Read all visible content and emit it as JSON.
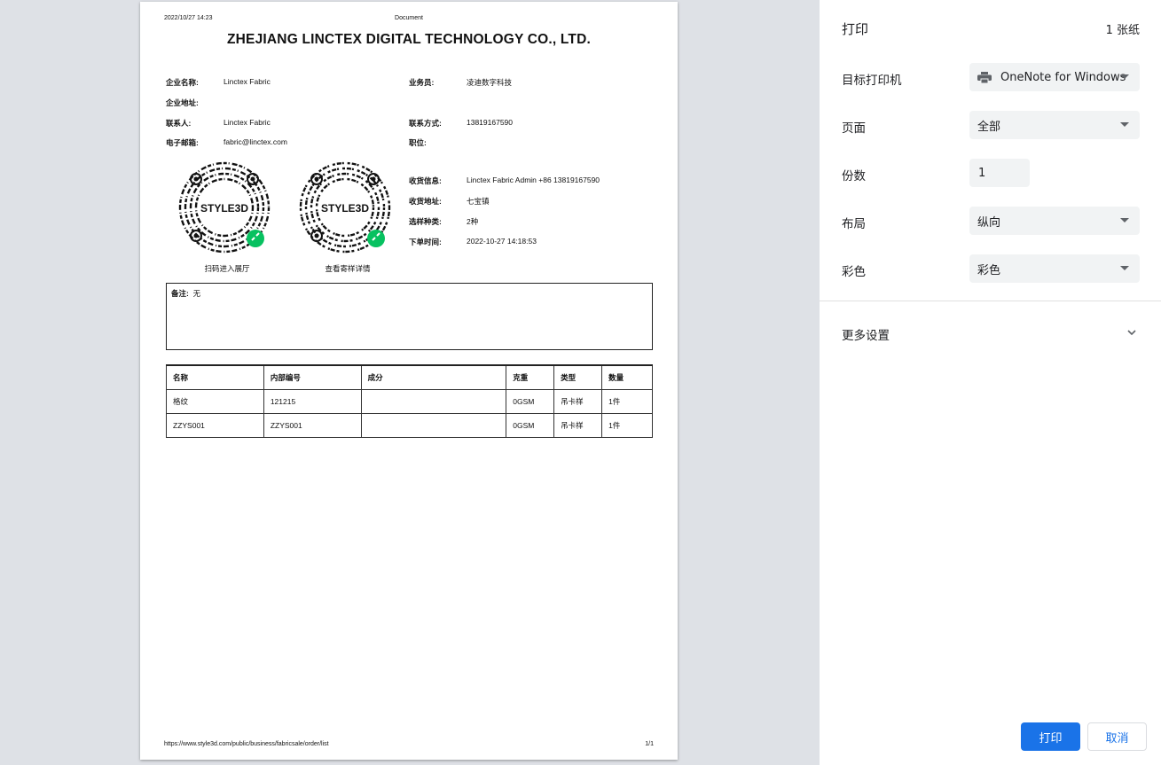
{
  "document": {
    "header_date": "2022/10/27 14:23",
    "header_title": "Document",
    "company": "ZHEJIANG LINCTEX DIGITAL TECHNOLOGY CO., LTD.",
    "fields_left": [
      {
        "label": "企业名称:",
        "value": "Linctex Fabric"
      },
      {
        "label": "企业地址:",
        "value": ""
      },
      {
        "label": "联系人:",
        "value": "Linctex Fabric"
      },
      {
        "label": "电子邮箱:",
        "value": "fabric@linctex.com"
      }
    ],
    "fields_right": [
      {
        "label": "业务员:",
        "value": "凌迪数字科技"
      },
      {
        "label": "",
        "value": ""
      },
      {
        "label": "联系方式:",
        "value": "13819167590"
      },
      {
        "label": "职位:",
        "value": ""
      }
    ],
    "shipping": [
      {
        "label": "收货信息:",
        "value": "Linctex Fabric Admin +86 13819167590"
      },
      {
        "label": "收货地址:",
        "value": "七宝镇"
      },
      {
        "label": "选样种类:",
        "value": "2种"
      },
      {
        "label": "下单时间:",
        "value": "2022-10-27 14:18:53"
      }
    ],
    "qr_codes": [
      {
        "caption": "扫码进入展厅",
        "logo": "STYLE3D"
      },
      {
        "caption": "查看寄样详情",
        "logo": "STYLE3D"
      }
    ],
    "remark_label": "备注:",
    "remark_value": "无",
    "table": {
      "headers": [
        "名称",
        "内部编号",
        "成分",
        "克重",
        "类型",
        "数量"
      ],
      "rows": [
        [
          "格纹",
          "121215",
          "",
          "0GSM",
          "吊卡样",
          "1件"
        ],
        [
          "ZZYS001",
          "ZZYS001",
          "",
          "0GSM",
          "吊卡样",
          "1件"
        ]
      ]
    },
    "footer_url": "https://www.style3d.com/public/business/fabricsale/order/list",
    "footer_page": "1/1"
  },
  "panel": {
    "title": "打印",
    "sheets": "1 张纸",
    "destination_label": "目标打印机",
    "destination_value": "OneNote for Windows",
    "pages_label": "页面",
    "pages_value": "全部",
    "copies_label": "份数",
    "copies_value": "1",
    "layout_label": "布局",
    "layout_value": "纵向",
    "color_label": "彩色",
    "color_value": "彩色",
    "more_settings": "更多设置",
    "print_button": "打印",
    "cancel_button": "取消",
    "accent_color": "#1a73e8"
  }
}
